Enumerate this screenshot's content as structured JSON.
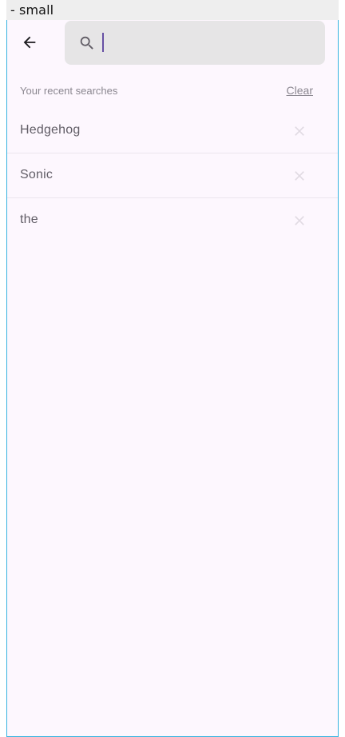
{
  "frame_label": "- small",
  "search": {
    "value": "",
    "placeholder": ""
  },
  "recent": {
    "title": "Your recent searches",
    "clear_label": "Clear",
    "items": [
      {
        "label": "Hedgehog"
      },
      {
        "label": "Sonic"
      },
      {
        "label": "the"
      }
    ]
  },
  "icons": {
    "back": "arrow-back-icon",
    "search": "search-icon",
    "remove": "close-icon"
  },
  "colors": {
    "background": "#fdf7fe",
    "search_bar": "#e6e5e6",
    "caret": "#6750a4",
    "frame_border": "#36b3e0",
    "muted_text": "#8b8790",
    "item_text": "#615d66",
    "close_icon": "#e1dbe3"
  }
}
